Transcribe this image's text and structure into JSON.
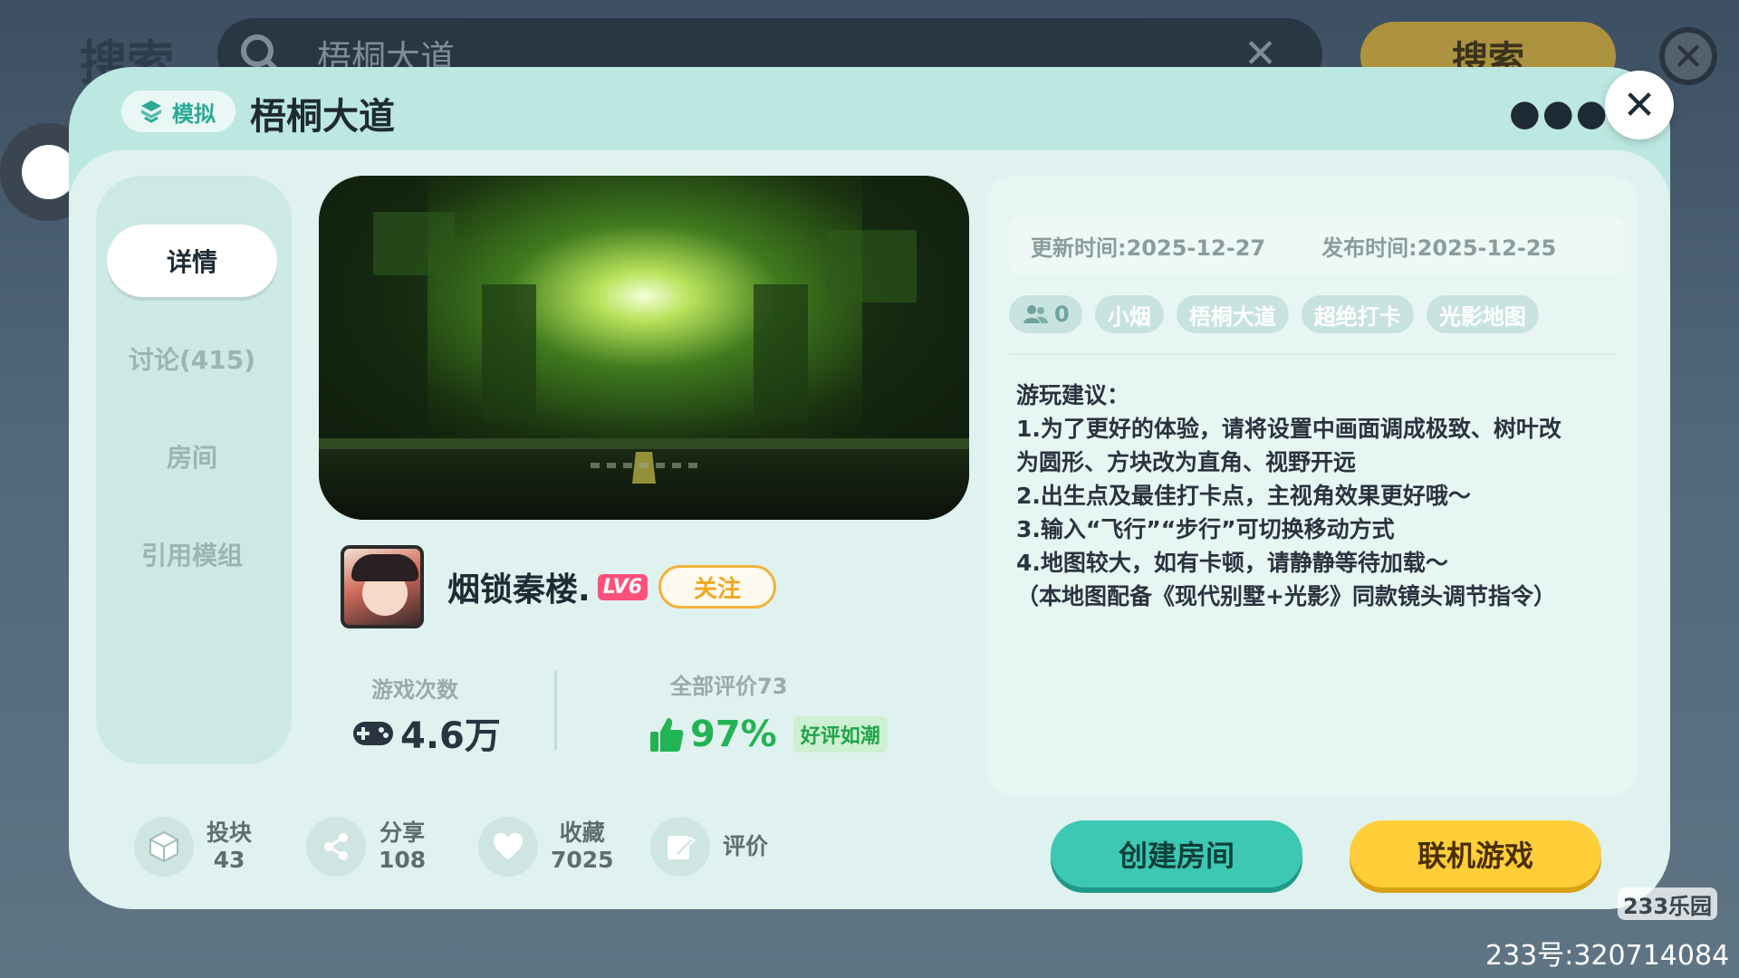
{
  "background": {
    "search_title": "搜索",
    "search_value": "梧桐大道",
    "clear_icon": "close-icon",
    "search_button": "搜索"
  },
  "header": {
    "category": "模拟",
    "title": "梧桐大道",
    "more_icon": "more-icon",
    "close_icon": "close-icon"
  },
  "tabs": [
    {
      "label": "详情",
      "active": true
    },
    {
      "label": "讨论(415)",
      "active": false
    },
    {
      "label": "房间",
      "active": false
    },
    {
      "label": "引用模组",
      "active": false
    }
  ],
  "author": {
    "name": "烟锁秦楼.",
    "level": "LV6",
    "follow_label": "关注"
  },
  "stats": {
    "plays_label": "游戏次数",
    "plays_value": "4.6万",
    "rating_label": "全部评价73",
    "rating_percent": "97%",
    "rating_badge": "好评如潮"
  },
  "info": {
    "updated": "更新时间:2025-12-27",
    "published": "发布时间:2025-12-25",
    "players_count": "0",
    "tags": [
      "小烟",
      "梧桐大道",
      "超绝打卡",
      "光影地图"
    ],
    "description": [
      "游玩建议：",
      "1.为了更好的体验，请将设置中画面调成极致、树叶改",
      "为圆形、方块改为直角、视野开远",
      "2.出生点及最佳打卡点，主视角效果更好哦～",
      "3.输入“飞行”“步行”可切换移动方式",
      "4.地图较大，如有卡顿，请静静等待加载～",
      "（本地图配备《现代别墅+光影》同款镜头调节指令）"
    ]
  },
  "actions": {
    "blocks_label": "投块",
    "blocks_count": "43",
    "share_label": "分享",
    "share_count": "108",
    "fav_label": "收藏",
    "fav_count": "7025",
    "review_label": "评价",
    "create_room": "创建房间",
    "online_game": "联机游戏"
  },
  "watermark": {
    "logo": "233乐园",
    "id": "233号:320714084"
  },
  "colors": {
    "accent": "#3cc8b2",
    "primary_button": "#ffcf3a",
    "rating_green": "#22b454",
    "modal_bg": "#e0f2ef"
  }
}
